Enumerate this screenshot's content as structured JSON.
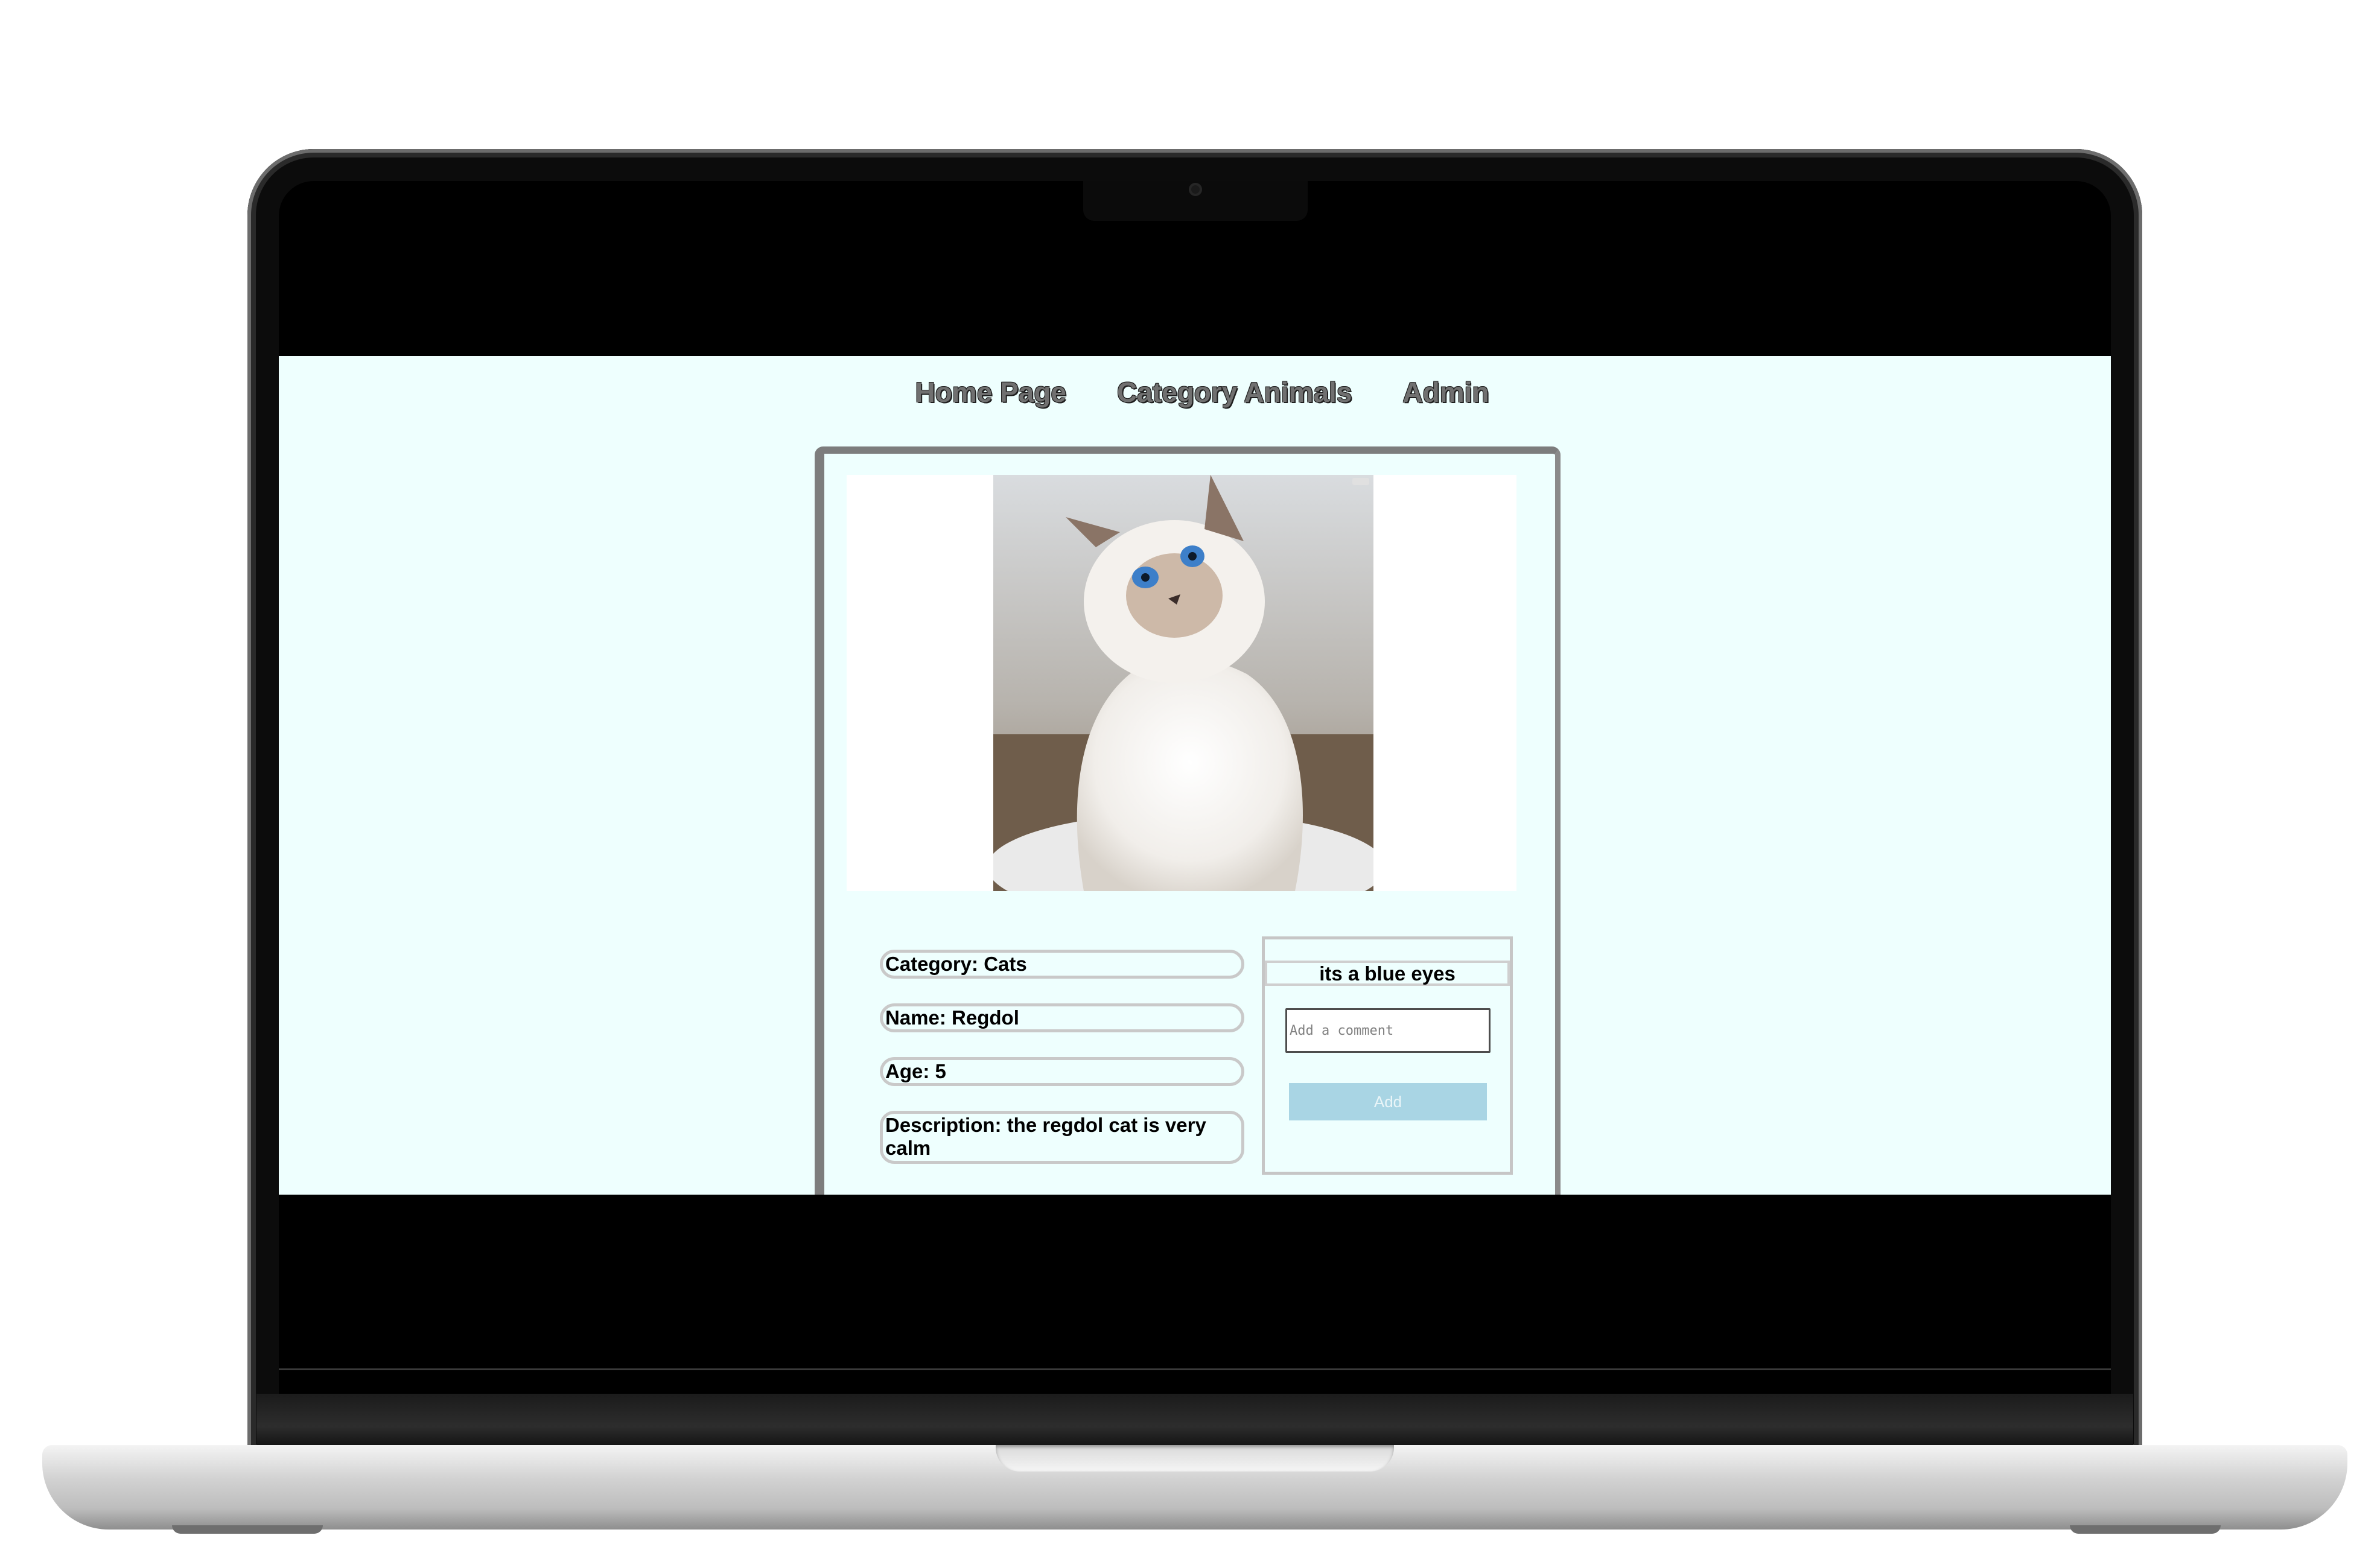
{
  "nav": {
    "home": "Home Page",
    "category": "Category Animals",
    "admin": "Admin"
  },
  "animal": {
    "category": "Category: Cats",
    "name": "Name: Regdol",
    "age": "Age: 5",
    "description": "Description: the regdol cat is very calm",
    "image_icon": "cat-photo"
  },
  "comments": {
    "items": [
      "its a blue eyes"
    ],
    "placeholder": "Add a comment",
    "add_label": "Add"
  },
  "colors": {
    "page_background": "#eefffe",
    "add_button": "#a9d5e4"
  }
}
